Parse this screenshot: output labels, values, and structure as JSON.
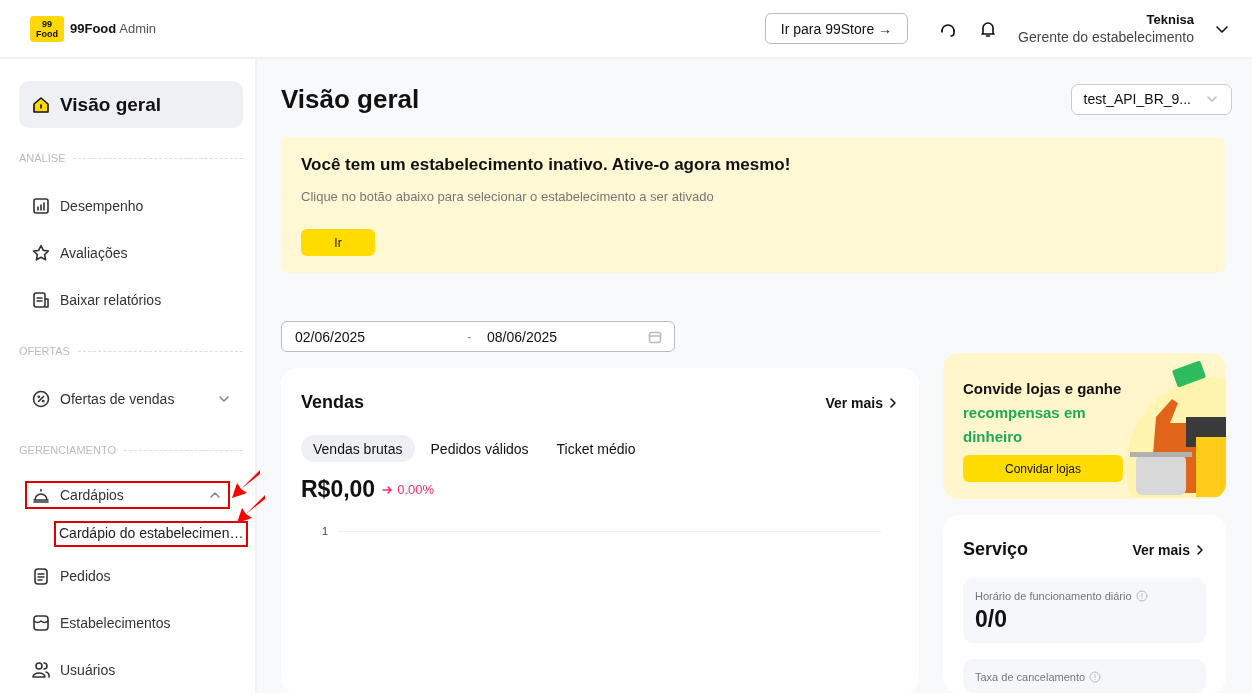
{
  "header": {
    "logo_badge": "99 Food",
    "brand": "99Food",
    "brand_suffix": "Admin",
    "store_button": "Ir para 99Store →",
    "user_name": "Teknisa",
    "user_role": "Gerente do estabelecimento"
  },
  "sidebar": {
    "items": [
      {
        "kind": "item",
        "label": "Visão geral",
        "selected": true,
        "highlighted": false
      },
      {
        "kind": "section",
        "label": "ANÁLISE"
      },
      {
        "kind": "item",
        "label": "Desempenho",
        "selected": false,
        "highlighted": false
      },
      {
        "kind": "item",
        "label": "Avaliações",
        "selected": false,
        "highlighted": false
      },
      {
        "kind": "item",
        "label": "Baixar relatórios",
        "selected": false,
        "highlighted": false
      },
      {
        "kind": "section",
        "label": "OFERTAS"
      },
      {
        "kind": "group",
        "label": "Ofertas de vendas",
        "selected": false,
        "highlighted": false,
        "expanded": false
      },
      {
        "kind": "section",
        "label": "GERENCIAMENTO"
      },
      {
        "kind": "group",
        "label": "Cardápios",
        "selected": false,
        "highlighted": true,
        "expanded": true,
        "children": [
          {
            "label": "Cardápio do estabelecimen…",
            "highlighted": true
          }
        ]
      },
      {
        "kind": "item",
        "label": "Pedidos",
        "selected": false,
        "highlighted": false
      },
      {
        "kind": "item",
        "label": "Estabelecimentos",
        "selected": false,
        "highlighted": false
      },
      {
        "kind": "item",
        "label": "Usuários",
        "selected": false,
        "highlighted": false
      }
    ]
  },
  "page": {
    "title": "Visão geral",
    "store_select": "test_API_BR_9..."
  },
  "banner": {
    "title": "Você tem um estabelecimento inativo. Ative-o agora mesmo!",
    "text": "Clique no botão abaixo para selecionar o estabelecimento a ser ativado",
    "button": "Ir"
  },
  "date_range": {
    "start": "02/06/2025",
    "separator": "-",
    "end": "08/06/2025"
  },
  "sales": {
    "title": "Vendas",
    "more": "Ver mais",
    "tabs": [
      {
        "label": "Vendas brutas",
        "selected": true
      },
      {
        "label": "Pedidos válidos",
        "selected": false
      },
      {
        "label": "Ticket médio",
        "selected": false
      }
    ],
    "value": "R$0,00",
    "change": "0.00%",
    "axis_label": "1"
  },
  "promo": {
    "title": "Convide lojas e ganhe **recompensas em dinheiro**",
    "button": "Convidar lojas"
  },
  "service": {
    "title": "Serviço",
    "more": "Ver mais",
    "metrics": [
      {
        "label": "Horário de funcionamento diário",
        "value": "0/0"
      },
      {
        "label": "Taxa de cancelamento"
      }
    ]
  }
}
